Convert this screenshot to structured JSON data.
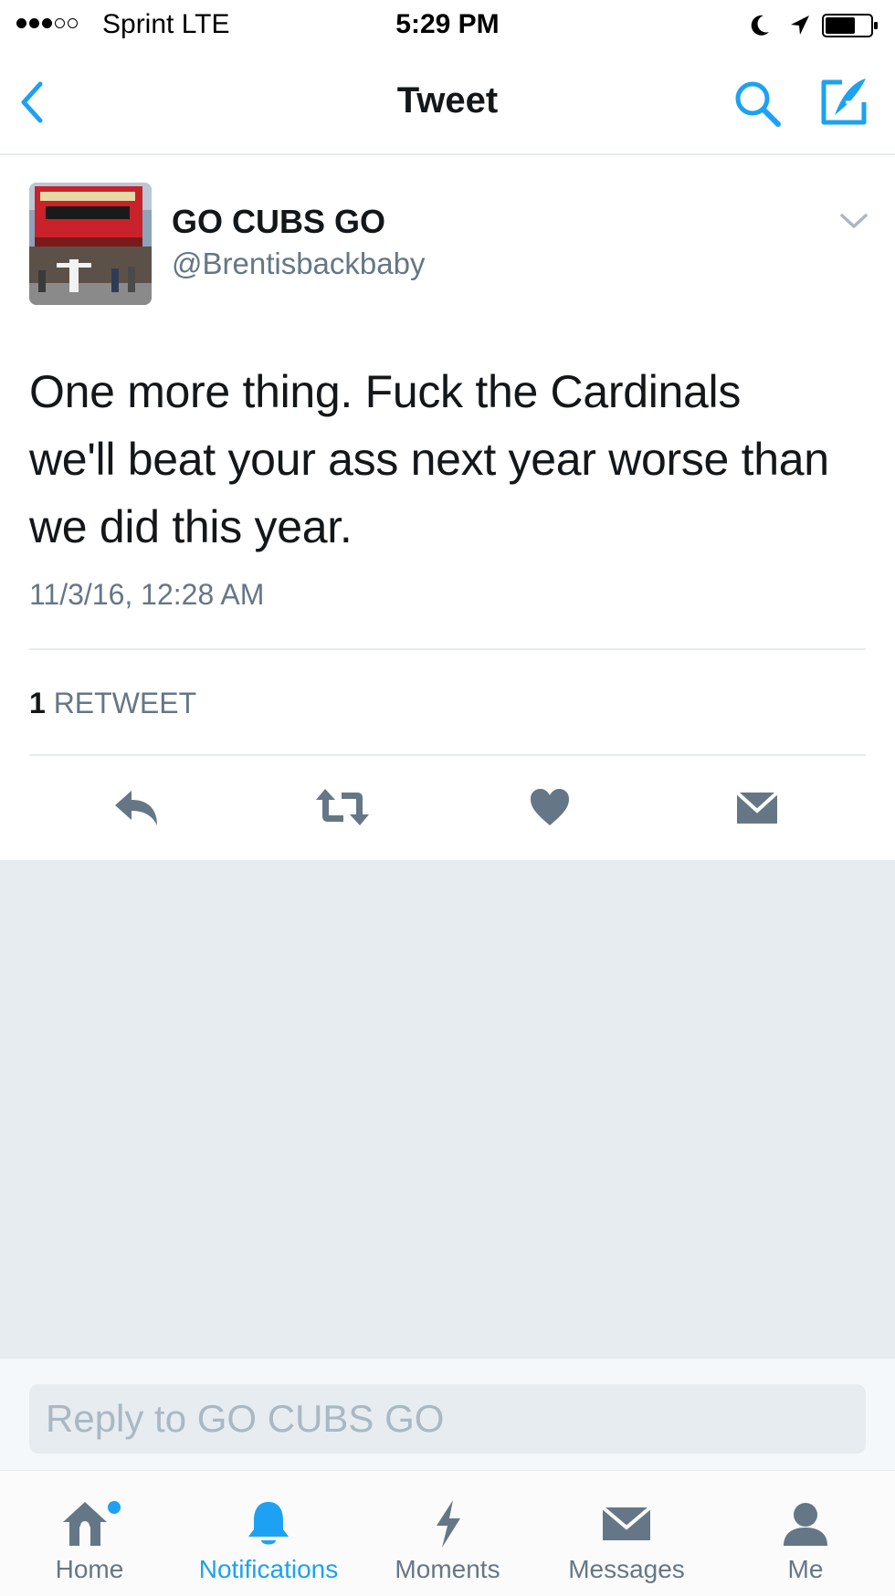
{
  "status_bar": {
    "carrier": "Sprint  LTE",
    "time": "5:29 PM"
  },
  "nav": {
    "title": "Tweet",
    "back_icon": "chevron-left-icon",
    "search_icon": "search-icon",
    "compose_icon": "compose-icon"
  },
  "tweet": {
    "display_name": "GO CUBS GO",
    "handle": "@Brentisbackbaby",
    "text_lines": [
      "One more thing. Fuck the Cardinals",
      "we'll beat your ass next year worse than",
      "we did this year."
    ],
    "timestamp": "11/3/16, 12:28 AM",
    "retweet_count": "1",
    "retweet_label": "RETWEET"
  },
  "actions": [
    "reply-icon",
    "retweet-icon",
    "like-icon",
    "direct-message-icon"
  ],
  "reply": {
    "placeholder": "Reply to GO CUBS GO"
  },
  "tabs": [
    {
      "label": "Home",
      "icon": "home-icon",
      "active": false
    },
    {
      "label": "Notifications",
      "icon": "bell-icon",
      "active": true
    },
    {
      "label": "Moments",
      "icon": "lightning-icon",
      "active": false
    },
    {
      "label": "Messages",
      "icon": "envelope-icon",
      "active": false
    },
    {
      "label": "Me",
      "icon": "person-icon",
      "active": false
    }
  ],
  "colors": {
    "accent": "#1da1f2",
    "text_primary": "#14171a",
    "text_secondary": "#657786",
    "icon_gray": "#657786",
    "divider": "#e6ecf0"
  }
}
